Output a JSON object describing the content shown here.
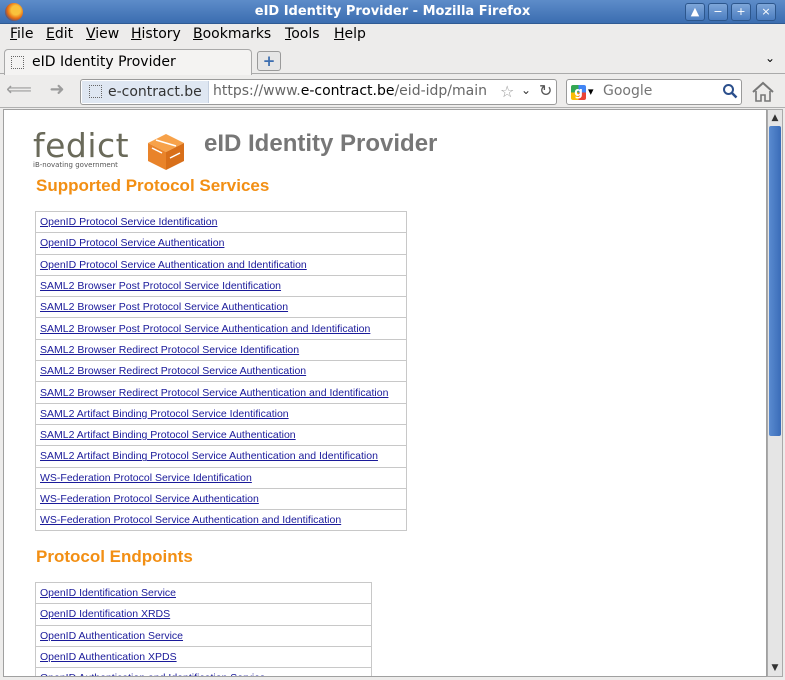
{
  "window": {
    "title": "eID Identity Provider - Mozilla Firefox",
    "buttons": [
      "▲",
      "−",
      "+",
      "×"
    ]
  },
  "menu": [
    "File",
    "Edit",
    "View",
    "History",
    "Bookmarks",
    "Tools",
    "Help"
  ],
  "tabs": [
    {
      "label": "eID Identity Provider"
    }
  ],
  "newtab_label": "+",
  "tablist_glyph": "⌄",
  "nav": {
    "back_glyph": "⟸",
    "forward_glyph": "➜",
    "identity": "e-contract.be",
    "url_prefix": "https://www.",
    "url_host": "e-contract.be",
    "url_path": "/eid-idp/main",
    "star_glyph": "☆",
    "dropdown_glyph": "⌄",
    "reload_glyph": "↻"
  },
  "search": {
    "engine_glyph": "g",
    "placeholder": "Google",
    "dropdown_glyph": "▾"
  },
  "page": {
    "logo_text": "fedict",
    "logo_tagline": "iB-novating government",
    "title": "eID Identity Provider",
    "sections": [
      {
        "heading": "Supported Protocol Services",
        "links": [
          "OpenID Protocol Service Identification",
          "OpenID Protocol Service Authentication",
          "OpenID Protocol Service Authentication and Identification",
          "SAML2 Browser Post Protocol Service Identification",
          "SAML2 Browser Post Protocol Service Authentication",
          "SAML2 Browser Post Protocol Service Authentication and Identification",
          "SAML2 Browser Redirect Protocol Service Identification",
          "SAML2 Browser Redirect Protocol Service Authentication",
          "SAML2 Browser Redirect Protocol Service Authentication and Identification",
          "SAML2 Artifact Binding Protocol Service Identification",
          "SAML2 Artifact Binding Protocol Service Authentication",
          "SAML2 Artifact Binding Protocol Service Authentication and Identification",
          "WS-Federation Protocol Service Identification",
          "WS-Federation Protocol Service Authentication",
          "WS-Federation Protocol Service Authentication and Identification"
        ]
      },
      {
        "heading": "Protocol Endpoints",
        "links": [
          "OpenID Identification Service",
          "OpenID Identification XRDS",
          "OpenID Authentication Service",
          "OpenID Authentication XPDS",
          "OpenID Authentication and Identification Service"
        ]
      }
    ]
  },
  "scrollbar": {
    "up_glyph": "▲",
    "down_glyph": "▼",
    "position": 0.0
  }
}
